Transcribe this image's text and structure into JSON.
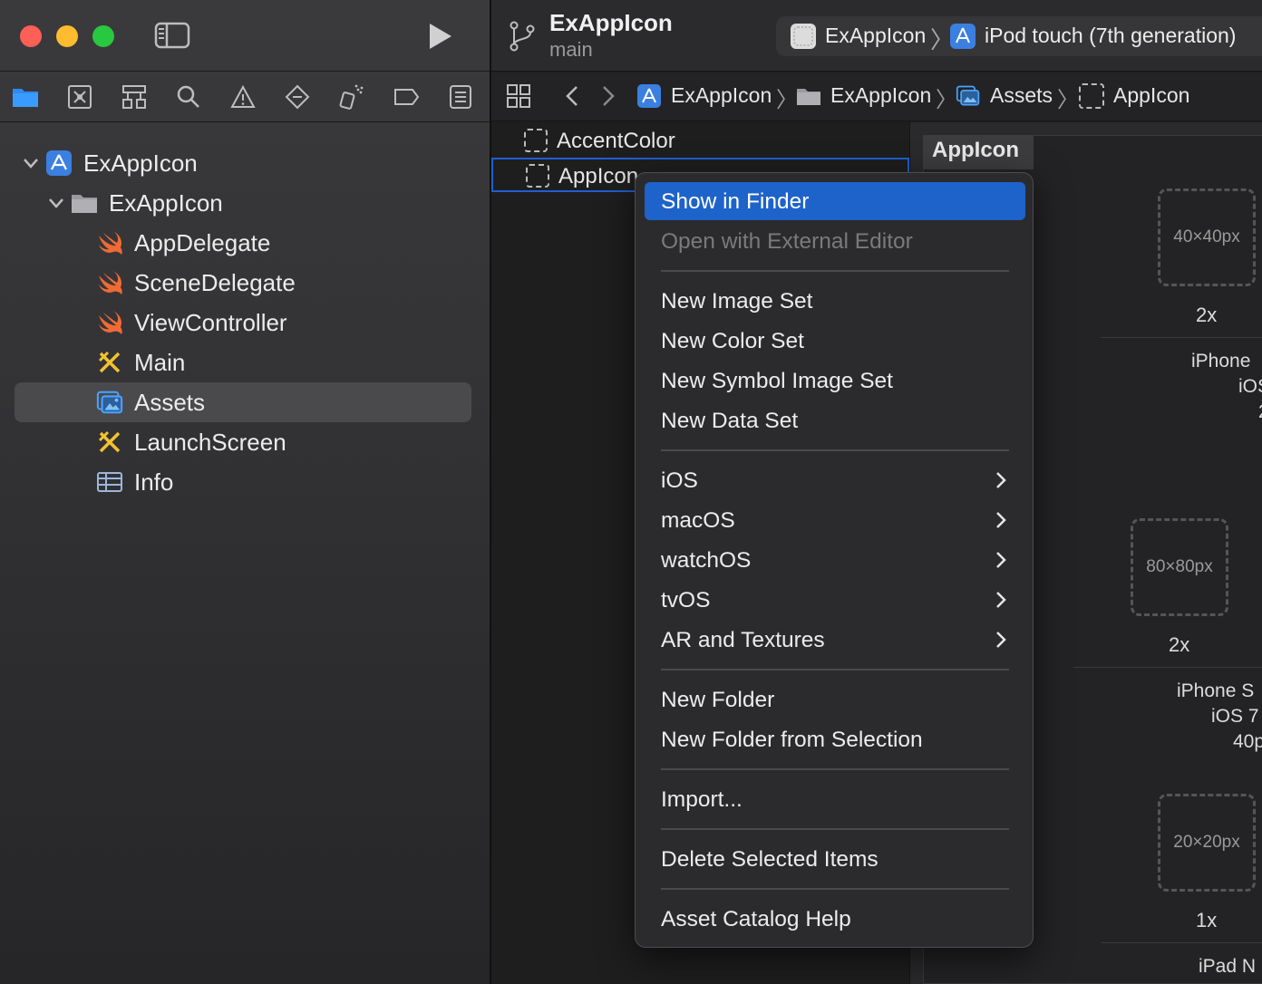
{
  "window": {
    "project_title": "ExAppIcon",
    "branch": "main"
  },
  "scheme": {
    "target": "ExAppIcon",
    "device": "iPod touch (7th generation)"
  },
  "jump_bar": {
    "items": [
      "ExAppIcon",
      "ExAppIcon",
      "Assets",
      "AppIcon"
    ]
  },
  "navigator": {
    "tabs": [
      "folder-icon",
      "source-control-icon",
      "symbol-icon",
      "search-icon",
      "warning-icon",
      "test-icon",
      "debug-icon",
      "breakpoint-icon",
      "report-icon"
    ],
    "tree": [
      {
        "label": "ExAppIcon",
        "type": "project"
      },
      {
        "label": "ExAppIcon",
        "type": "folder"
      },
      {
        "label": "AppDelegate",
        "type": "swift"
      },
      {
        "label": "SceneDelegate",
        "type": "swift"
      },
      {
        "label": "ViewController",
        "type": "swift"
      },
      {
        "label": "Main",
        "type": "storyboard"
      },
      {
        "label": "Assets",
        "type": "assets",
        "selected": true
      },
      {
        "label": "LaunchScreen",
        "type": "storyboard"
      },
      {
        "label": "Info",
        "type": "plist"
      }
    ]
  },
  "assets": {
    "items": [
      {
        "label": "AccentColor"
      },
      {
        "label": "AppIcon",
        "selected": true
      }
    ]
  },
  "detail": {
    "tab": "AppIcon",
    "slots": [
      {
        "size": "40×40px",
        "scale": "2x"
      },
      {
        "size": "80×80px",
        "scale": "2x"
      },
      {
        "size": "20×20px",
        "scale": "1x"
      }
    ],
    "texts": {
      "g1_line1": "iPhone",
      "g1_line2": "iOS",
      "g1_line3": "2",
      "g2_line1": "iPhone S",
      "g2_line2": "iOS 7",
      "g2_line3": "40p",
      "g3_line1": "iPad N"
    }
  },
  "context_menu": {
    "show_in_finder": "Show in Finder",
    "open_external": "Open with External Editor",
    "new_image_set": "New Image Set",
    "new_color_set": "New Color Set",
    "new_symbol_image_set": "New Symbol Image Set",
    "new_data_set": "New Data Set",
    "ios": "iOS",
    "macos": "macOS",
    "watchos": "watchOS",
    "tvos": "tvOS",
    "ar_textures": "AR and Textures",
    "new_folder": "New Folder",
    "new_folder_selection": "New Folder from Selection",
    "import": "Import...",
    "delete_selected": "Delete Selected Items",
    "help": "Asset Catalog Help"
  },
  "colors": {
    "accent": "#1e63c9",
    "swift": "#f05138",
    "sidebar_bg": "#353537"
  }
}
